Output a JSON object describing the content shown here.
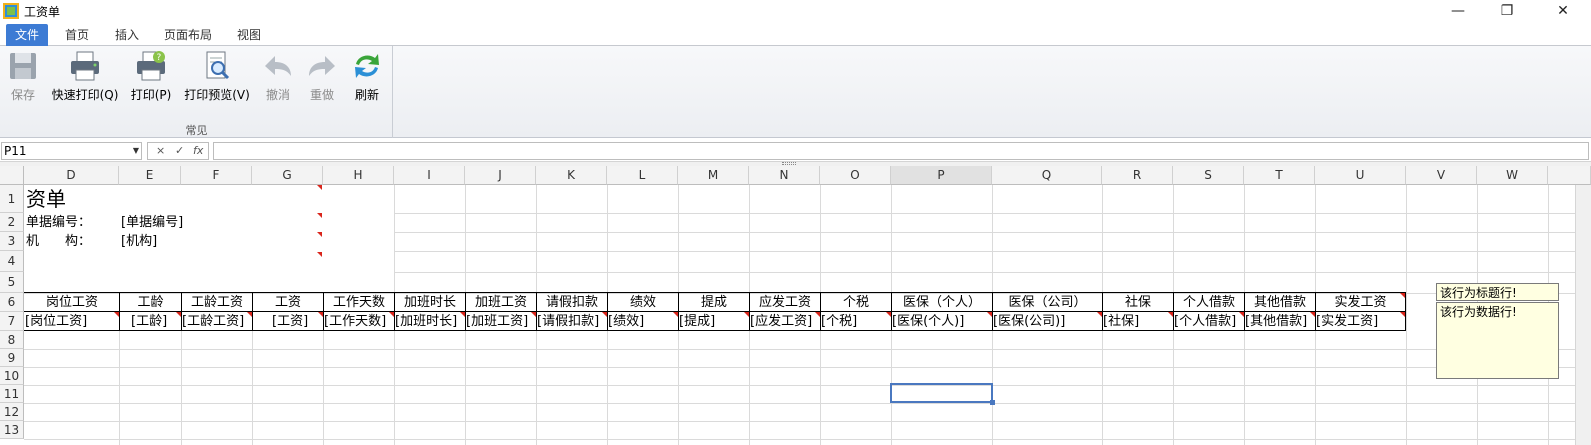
{
  "window": {
    "title": "工资单",
    "minimize_glyph": "—",
    "restore_glyph": "❐",
    "close_glyph": "✕"
  },
  "ribbon_tabs": [
    "文件",
    "首页",
    "插入",
    "页面布局",
    "视图"
  ],
  "active_tab": "文件",
  "ribbon": {
    "group_label": "常见",
    "buttons": [
      {
        "label": "保存",
        "icon": "save-icon",
        "enabled": false
      },
      {
        "label": "快速打印(Q)",
        "icon": "quick-print-icon",
        "enabled": true
      },
      {
        "label": "打印(P)",
        "icon": "print-icon",
        "enabled": true
      },
      {
        "label": "打印预览(V)",
        "icon": "print-preview-icon",
        "enabled": true
      },
      {
        "label": "撤消",
        "icon": "undo-icon",
        "enabled": false
      },
      {
        "label": "重做",
        "icon": "redo-icon",
        "enabled": false
      },
      {
        "label": "刷新",
        "icon": "refresh-icon",
        "enabled": true
      }
    ]
  },
  "formula_bar": {
    "name_box": "P11",
    "cancel_glyph": "×",
    "enter_glyph": "✓",
    "fx_glyph": "fx",
    "formula": ""
  },
  "columns": [
    "D",
    "E",
    "F",
    "G",
    "H",
    "I",
    "J",
    "K",
    "L",
    "M",
    "N",
    "O",
    "P",
    "Q",
    "R",
    "S",
    "T",
    "U",
    "V",
    "W"
  ],
  "rows": [
    "1",
    "2",
    "3",
    "4",
    "5",
    "6",
    "7",
    "8",
    "9",
    "10",
    "11",
    "12",
    "13"
  ],
  "sheet": {
    "title": "资单",
    "bill_no_label": "单据编号：",
    "bill_no_value": "[单据编号]",
    "org_label": "机　　构：",
    "org_value": "[机构]",
    "header_row": [
      "岗位工资",
      "工龄",
      "工龄工资",
      "工资",
      "工作天数",
      "加班时长",
      "加班工资",
      "请假扣款",
      "绩效",
      "提成",
      "应发工资",
      "个税",
      "医保（个人）",
      "医保（公司）",
      "社保",
      "个人借款",
      "其他借款",
      "实发工资"
    ],
    "data_row": [
      "[岗位工资]",
      "[工龄]",
      "[工龄工资]",
      "[工资]",
      "[工作天数]",
      "[加班时长]",
      "[加班工资]",
      "[请假扣款]",
      "[绩效]",
      "[提成]",
      "[应发工资]",
      "[个税]",
      "[医保(个人)]",
      "[医保(公司)]",
      "[社保]",
      "[个人借款]",
      "[其他借款]",
      "[实发工资]"
    ],
    "selected_cell": "P11"
  },
  "notes": {
    "header_note": "该行为标题行!",
    "data_note": "该行为数据行!"
  },
  "colors": {
    "active_tab": "#3d7bd4",
    "comment_marker": "#d9261c",
    "selection": "#4a78c0",
    "note_bg": "#ffffe1"
  }
}
